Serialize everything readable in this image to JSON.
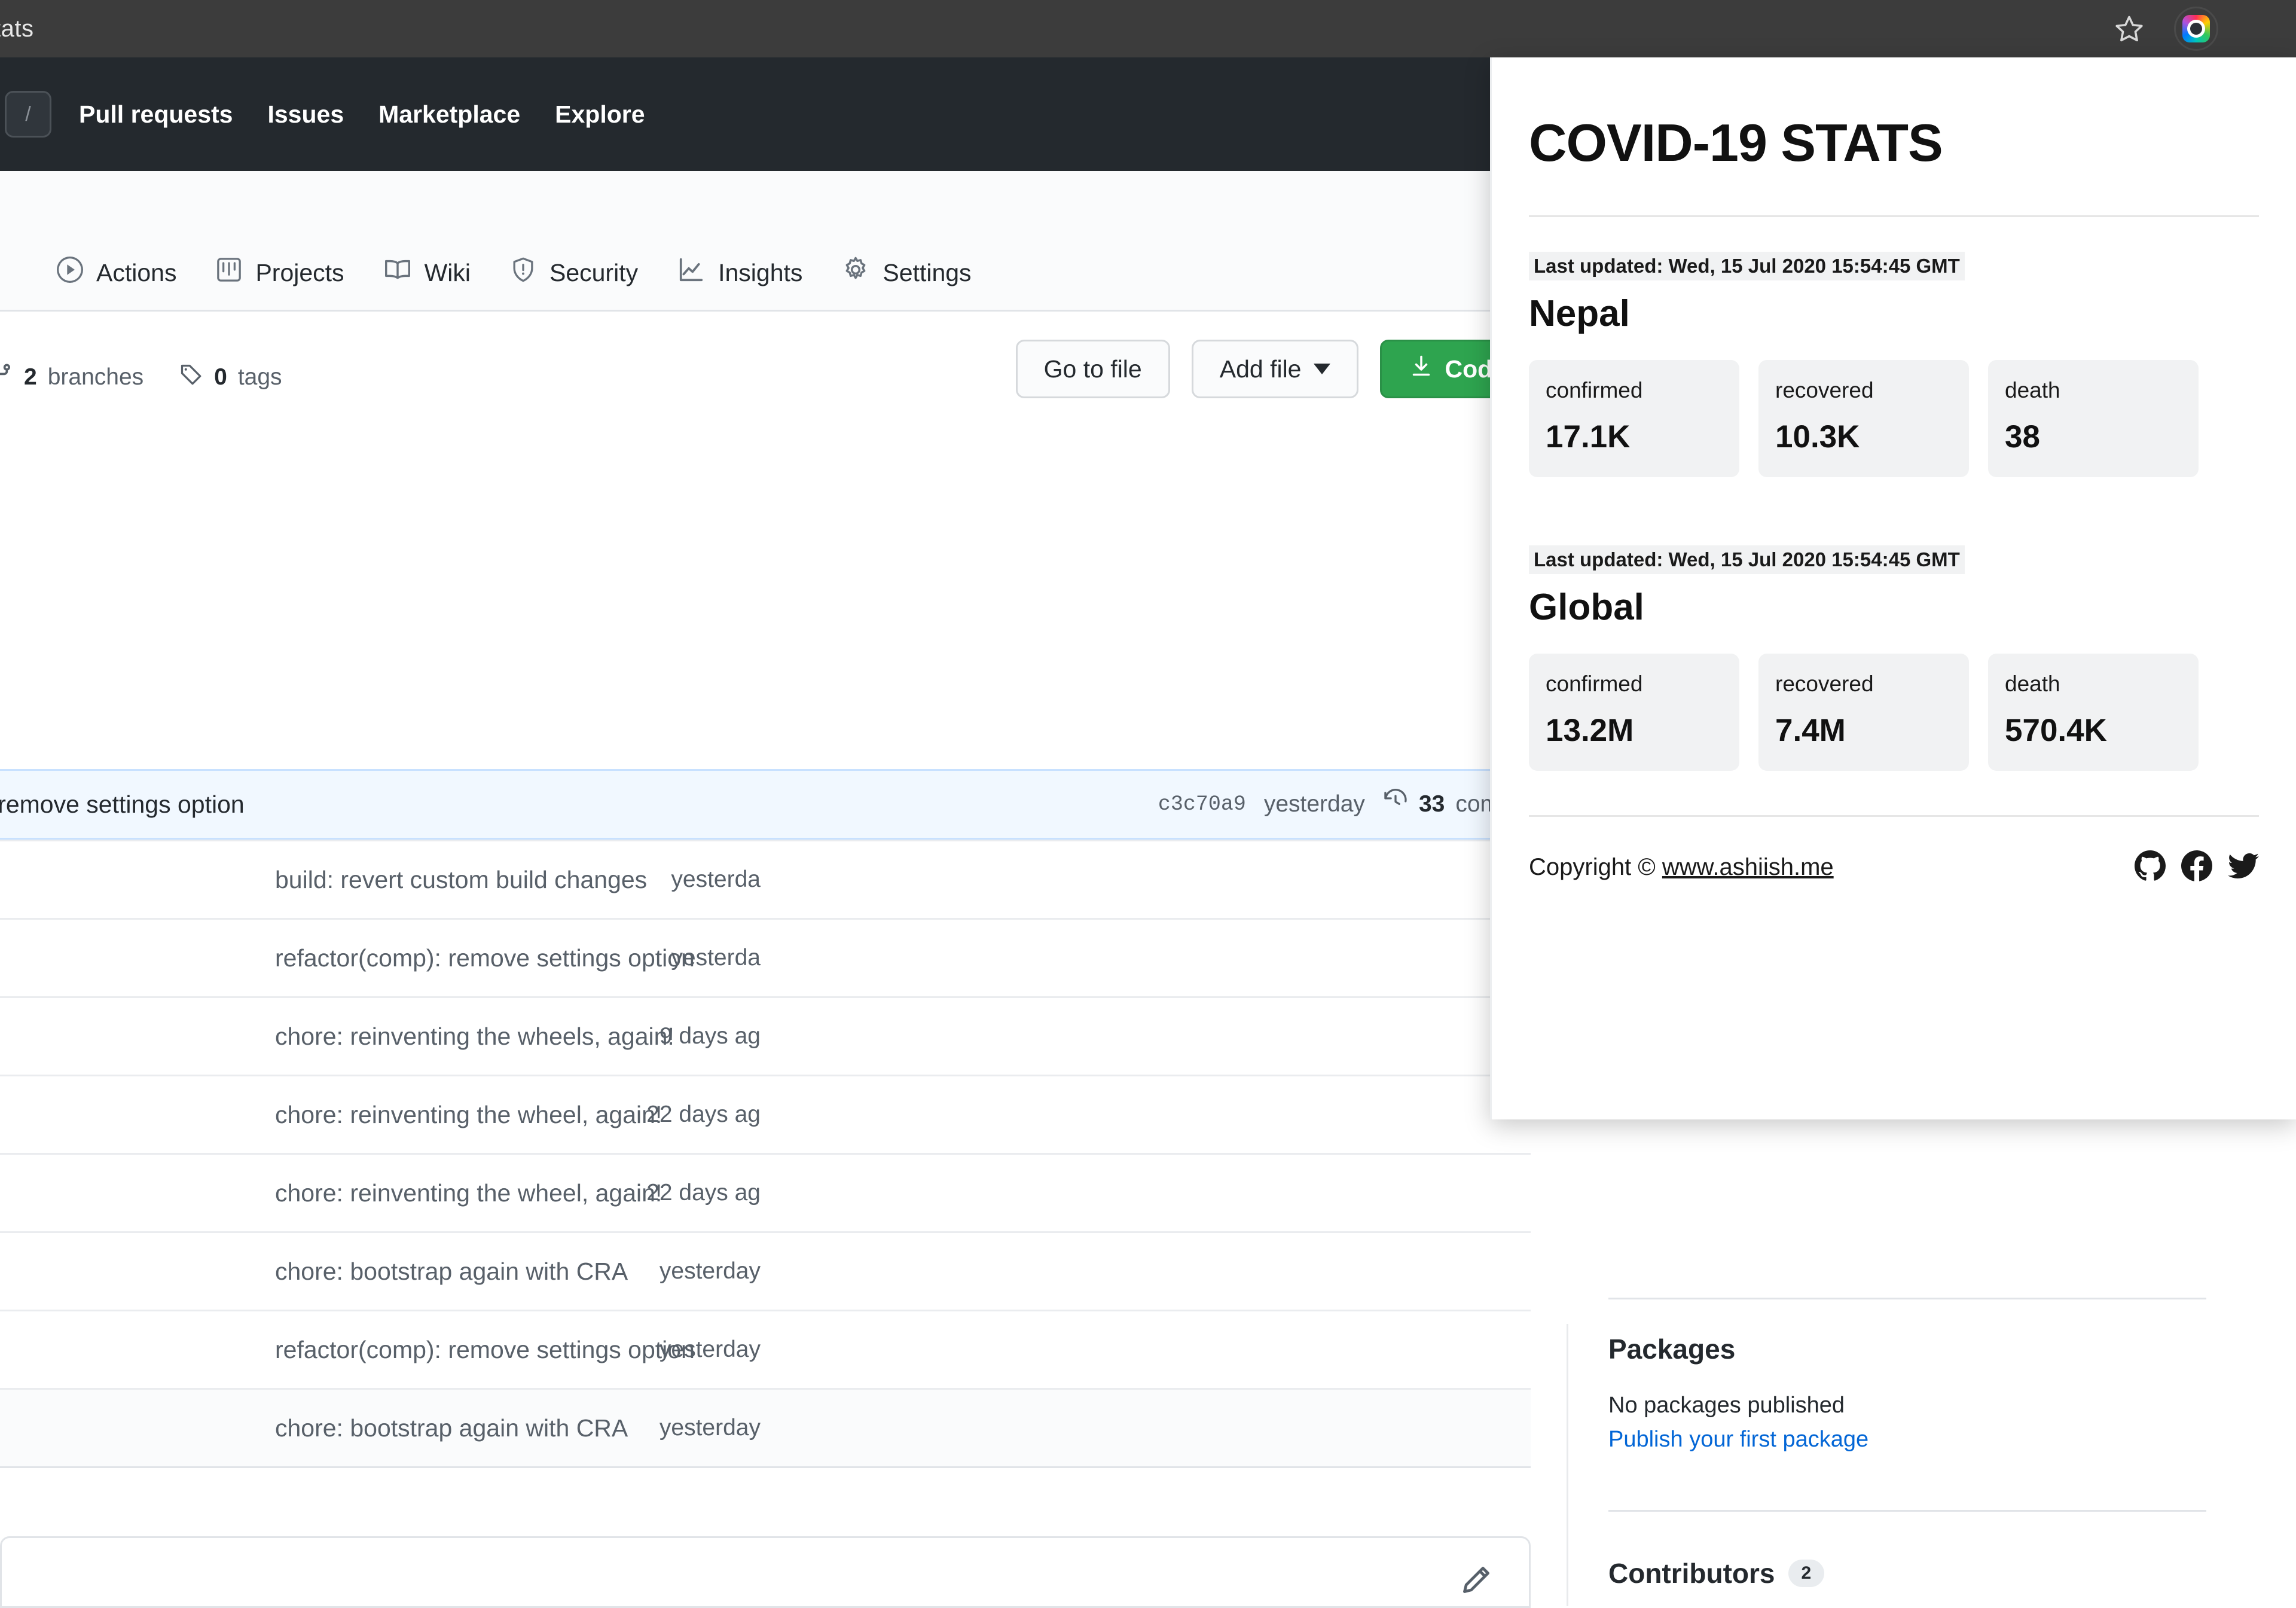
{
  "browser": {
    "tab_title": "tats",
    "bookmark_icon": "star-icon",
    "extension_icon": "colorful-extension-icon"
  },
  "github_header": {
    "search_shortcut": "/",
    "nav": [
      {
        "label": "Pull requests"
      },
      {
        "label": "Issues"
      },
      {
        "label": "Marketplace"
      },
      {
        "label": "Explore"
      }
    ]
  },
  "repo_tabs": [
    {
      "label": "Actions",
      "icon": "play-circle-icon"
    },
    {
      "label": "Projects",
      "icon": "project-board-icon"
    },
    {
      "label": "Wiki",
      "icon": "book-icon"
    },
    {
      "label": "Security",
      "icon": "shield-icon"
    },
    {
      "label": "Insights",
      "icon": "graph-icon"
    },
    {
      "label": "Settings",
      "icon": "gear-icon"
    }
  ],
  "branch_bar": {
    "branches_count": "2",
    "branches_label": "branches",
    "tags_count": "0",
    "tags_label": "tags",
    "go_to_file": "Go to file",
    "add_file": "Add file",
    "code": "Code",
    "code_color": "#2ea44f"
  },
  "latest_commit": {
    "message": "omp): remove settings option",
    "sha": "c3c70a9",
    "when": "yesterday",
    "commits_count": "33",
    "commits_label": "commit"
  },
  "files": [
    {
      "message": "build: revert custom build changes",
      "when": "yesterda"
    },
    {
      "message": "refactor(comp): remove settings option",
      "when": "yesterda"
    },
    {
      "message": "chore: reinventing the wheels, again!",
      "when": "9 days ag"
    },
    {
      "message": "chore: reinventing the wheel, again!",
      "when": "22 days ag"
    },
    {
      "message": "chore: reinventing the wheel, again!",
      "when": "22 days ag"
    },
    {
      "message": "chore: bootstrap again with CRA",
      "when": "yesterday"
    },
    {
      "message": "refactor(comp): remove settings option",
      "when": "yesterday"
    },
    {
      "message": "chore: bootstrap again with CRA",
      "when": "yesterday"
    }
  ],
  "sidebar": {
    "packages_heading": "Packages",
    "packages_empty": "No packages published",
    "packages_link": "Publish your first package",
    "contributors_heading": "Contributors",
    "contributors_count": "2"
  },
  "popup": {
    "title": "COVID-19 STATS",
    "sections": [
      {
        "updated": "Last updated: Wed, 15 Jul 2020 15:54:45 GMT",
        "region": "Nepal",
        "stats": [
          {
            "label": "confirmed",
            "value": "17.1K"
          },
          {
            "label": "recovered",
            "value": "10.3K"
          },
          {
            "label": "death",
            "value": "38"
          }
        ]
      },
      {
        "updated": "Last updated: Wed, 15 Jul 2020 15:54:45 GMT",
        "region": "Global",
        "stats": [
          {
            "label": "confirmed",
            "value": "13.2M"
          },
          {
            "label": "recovered",
            "value": "7.4M"
          },
          {
            "label": "death",
            "value": "570.4K"
          }
        ]
      }
    ],
    "footer": {
      "copyright_prefix": "Copyright © ",
      "site": "www.ashiish.me",
      "social": [
        "github-icon",
        "facebook-icon",
        "twitter-icon"
      ]
    }
  }
}
